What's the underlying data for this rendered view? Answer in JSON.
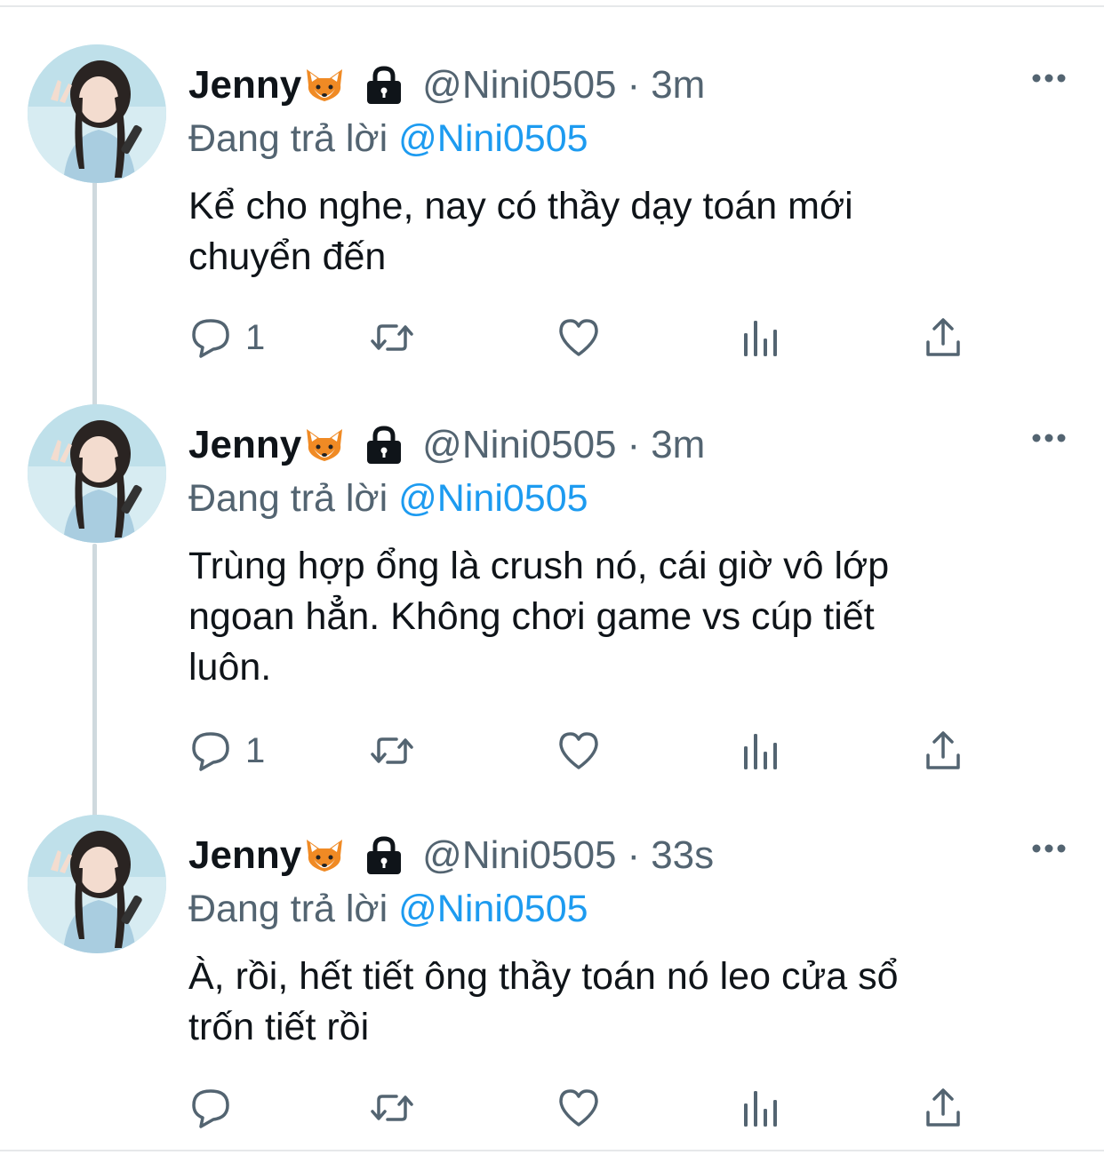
{
  "tweets": [
    {
      "name": "Jenny",
      "handle": "@Nini0505",
      "separator": "·",
      "time": "3m",
      "replying_label": "Đang trả lời",
      "replying_to": "@Nini0505",
      "text": "Kể cho nghe, nay có thầy dạy toán mới\nchuyển đến",
      "reply_count": "1"
    },
    {
      "name": "Jenny",
      "handle": "@Nini0505",
      "separator": "·",
      "time": "3m",
      "replying_label": "Đang trả lời",
      "replying_to": "@Nini0505",
      "text": "Trùng hợp ổng là crush nó, cái giờ vô lớp\nngoan hẳn. Không chơi game vs cúp tiết\nluôn.",
      "reply_count": "1"
    },
    {
      "name": "Jenny",
      "handle": "@Nini0505",
      "separator": "·",
      "time": "33s",
      "replying_label": "Đang trả lời",
      "replying_to": "@Nini0505",
      "text": "À, rồi, hết tiết ông thầy toán nó leo cửa sổ\ntrốn tiết rồi",
      "reply_count": ""
    }
  ],
  "icons": {
    "name_emoji": "fox-face",
    "protected": "lock-icon",
    "more": "more-icon",
    "reply": "reply-icon",
    "retweet": "retweet-icon",
    "like": "heart-icon",
    "views": "views-icon",
    "share": "share-icon"
  },
  "colors": {
    "text_primary": "#0f1419",
    "text_secondary": "#536471",
    "link": "#1d9bf0",
    "thread_line": "#cfd9de",
    "divider": "#e6e8ea"
  }
}
